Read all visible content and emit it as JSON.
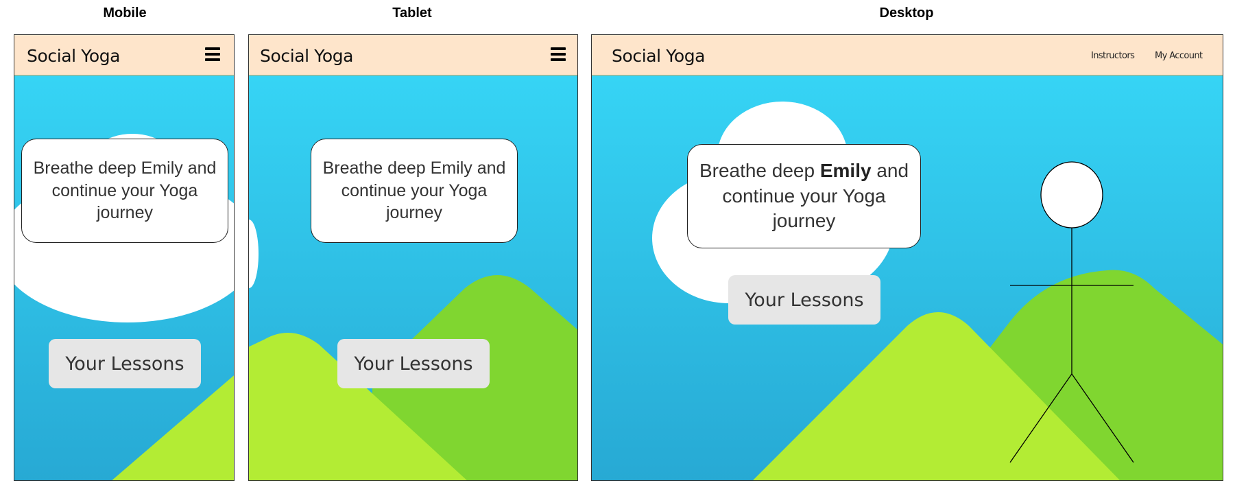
{
  "captions": {
    "mobile": "Mobile",
    "tablet": "Tablet",
    "desktop": "Desktop"
  },
  "brand": "Social Yoga",
  "nav": {
    "instructors": "Instructors",
    "account": "My Account"
  },
  "bubble_text": {
    "line1": "Breathe deep",
    "name": "Emily",
    "rest": "and continue your Yoga journey"
  },
  "cta_label": "Your Lessons",
  "colors": {
    "header_bg": "#fee5cb",
    "sky_top": "#36d4f5",
    "sky_bottom": "#27a9d4",
    "hill_light": "#b3ec34",
    "hill_dark": "#80d630",
    "cloud": "#ffffff",
    "button_bg": "#e6e6e6"
  }
}
